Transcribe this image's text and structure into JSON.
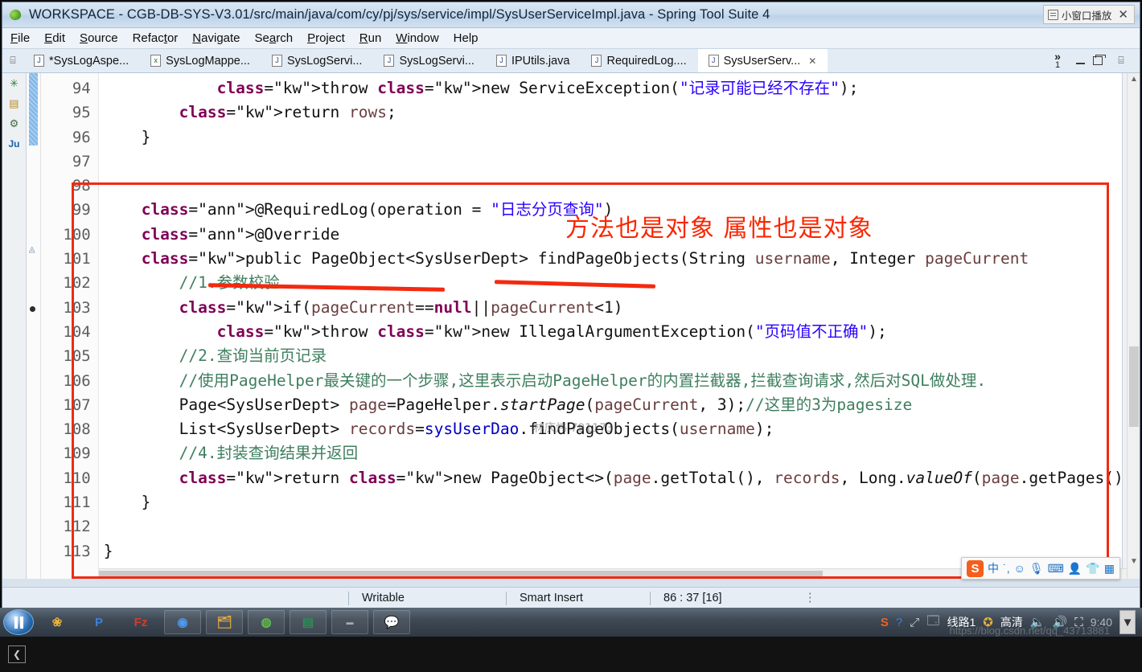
{
  "window": {
    "title": "WORKSPACE - CGB-DB-SYS-V3.01/src/main/java/com/cy/pj/sys/service/impl/SysUserServiceImpl.java - Spring Tool Suite 4",
    "app_icon": "spring-leaf-icon"
  },
  "float_pill": {
    "label": "小窗口播放",
    "close": "✕",
    "icon": "window-popout-icon"
  },
  "menubar": {
    "items": [
      {
        "label": "File",
        "mnemonic": "F"
      },
      {
        "label": "Edit",
        "mnemonic": "E"
      },
      {
        "label": "Source",
        "mnemonic": "S"
      },
      {
        "label": "Refactor",
        "mnemonic": "t"
      },
      {
        "label": "Navigate",
        "mnemonic": "N"
      },
      {
        "label": "Search",
        "mnemonic": "a"
      },
      {
        "label": "Project",
        "mnemonic": "P"
      },
      {
        "label": "Run",
        "mnemonic": "R"
      },
      {
        "label": "Window",
        "mnemonic": "W"
      },
      {
        "label": "Help",
        "mnemonic": ""
      }
    ]
  },
  "tabs": {
    "overflow_label": "»",
    "overflow_count": "1",
    "items": [
      {
        "label": "*SysLogAspe...",
        "icon": "java-file-icon",
        "type": "java",
        "active": false,
        "dirty": true
      },
      {
        "label": "SysLogMappe...",
        "icon": "xml-file-icon",
        "type": "xml",
        "active": false,
        "dirty": false
      },
      {
        "label": "SysLogServi...",
        "icon": "java-file-icon",
        "type": "java",
        "active": false,
        "dirty": false
      },
      {
        "label": "SysLogServi...",
        "icon": "java-file-icon",
        "type": "java",
        "active": false,
        "dirty": false
      },
      {
        "label": "IPUtils.java",
        "icon": "java-file-icon",
        "type": "java",
        "active": false,
        "dirty": false
      },
      {
        "label": "RequiredLog....",
        "icon": "java-file-icon",
        "type": "java",
        "active": false,
        "dirty": false
      },
      {
        "label": "SysUserServ...",
        "icon": "java-file-icon",
        "type": "java",
        "active": true,
        "dirty": false
      }
    ]
  },
  "editor": {
    "left_rail_icons": [
      "outline-icon",
      "copy-icon",
      "filter-icon",
      "junit-icon"
    ],
    "right_rail_icons": [
      "close-icon",
      "search-icon",
      "link-icon",
      "list-icon",
      "console-icon",
      "server-icon",
      "properties-icon",
      "download-icon",
      "power-icon"
    ],
    "line_numbers": [
      "94",
      "95",
      "96",
      "97",
      "98",
      "99",
      "100",
      "101",
      "102",
      "103",
      "104",
      "105",
      "106",
      "107",
      "108",
      "109",
      "110",
      "111",
      "112",
      "113"
    ],
    "lines": [
      {
        "n": "94",
        "text": "            throw new ServiceException(\"记录可能已经不存在\");"
      },
      {
        "n": "95",
        "text": "        return rows;"
      },
      {
        "n": "96",
        "text": "    }"
      },
      {
        "n": "97",
        "text": ""
      },
      {
        "n": "98",
        "text": ""
      },
      {
        "n": "99",
        "text": "    @RequiredLog(operation = \"日志分页查询\")"
      },
      {
        "n": "100",
        "text": "    @Override"
      },
      {
        "n": "101",
        "text": "    public PageObject<SysUserDept> findPageObjects(String username, Integer pageCurrent"
      },
      {
        "n": "102",
        "text": "        //1.参数校验"
      },
      {
        "n": "103",
        "text": "        if(pageCurrent==null||pageCurrent<1)"
      },
      {
        "n": "104",
        "text": "            throw new IllegalArgumentException(\"页码值不正确\");"
      },
      {
        "n": "105",
        "text": "        //2.查询当前页记录"
      },
      {
        "n": "106",
        "text": "        //使用PageHelper最关键的一个步骤,这里表示启动PageHelper的内置拦截器,拦截查询请求,然后对SQL做处理."
      },
      {
        "n": "107",
        "text": "        Page<SysUserDept> page=PageHelper.startPage(pageCurrent, 3);//这里的3为pagesize"
      },
      {
        "n": "108",
        "text": "        List<SysUserDept> records=sysUserDao.findPageObjects(username);"
      },
      {
        "n": "109",
        "text": "        //4.封装查询结果并返回"
      },
      {
        "n": "110",
        "text": "        return new PageObject<>(page.getTotal(), records, Long.valueOf(page.getPages()),"
      },
      {
        "n": "111",
        "text": "    }"
      },
      {
        "n": "112",
        "text": ""
      },
      {
        "n": "113",
        "text": "}"
      }
    ]
  },
  "annotation": {
    "note_text": "方法也是对象 属性也是对象",
    "box_color": "#ef2b12",
    "note_color": "#fa2600",
    "underline_color": "#f32a10"
  },
  "watermark": {
    "text": "林庆炜 791173"
  },
  "ime": {
    "brand": "S",
    "mode": "中",
    "icons": [
      "punctuation-icon",
      "emoji-icon",
      "microphone-icon",
      "keyboard-icon",
      "user-icon",
      "skin-icon",
      "apps-icon"
    ]
  },
  "statusbar": {
    "writable": "Writable",
    "insert_mode": "Smart Insert",
    "position": "86 : 37 [16]"
  },
  "taskbar": {
    "start_icon": "windows-start-icon",
    "items": [
      {
        "icon": "app-colorful-icon",
        "label": ""
      },
      {
        "icon": "pycharm-icon",
        "label": "P"
      },
      {
        "icon": "filezilla-icon",
        "label": "Fz"
      },
      {
        "icon": "chrome-icon",
        "label": ""
      },
      {
        "icon": "explorer-icon",
        "label": ""
      },
      {
        "icon": "browser-green-icon",
        "label": ""
      },
      {
        "icon": "notes-icon",
        "label": ""
      },
      {
        "icon": "tool-icon",
        "label": ""
      },
      {
        "icon": "wechat-icon",
        "label": ""
      }
    ]
  },
  "video_controls": {
    "sogou_icon": "sogou-icon",
    "help_icon": "help-icon",
    "expand_icon": "expand-icon",
    "route_label": "线路1",
    "quality_label": "高清",
    "speaker_icon": "speaker-icon",
    "volume_icon": "volume-icon",
    "fullscreen_icon": "fullscreen-icon",
    "time_label": "9:40",
    "scroll_down_icon": "chevron-down-icon"
  },
  "player": {
    "prev_icon": "chevron-left-icon",
    "url_watermark": "https://blog.csdn.net/qq_43713881"
  }
}
